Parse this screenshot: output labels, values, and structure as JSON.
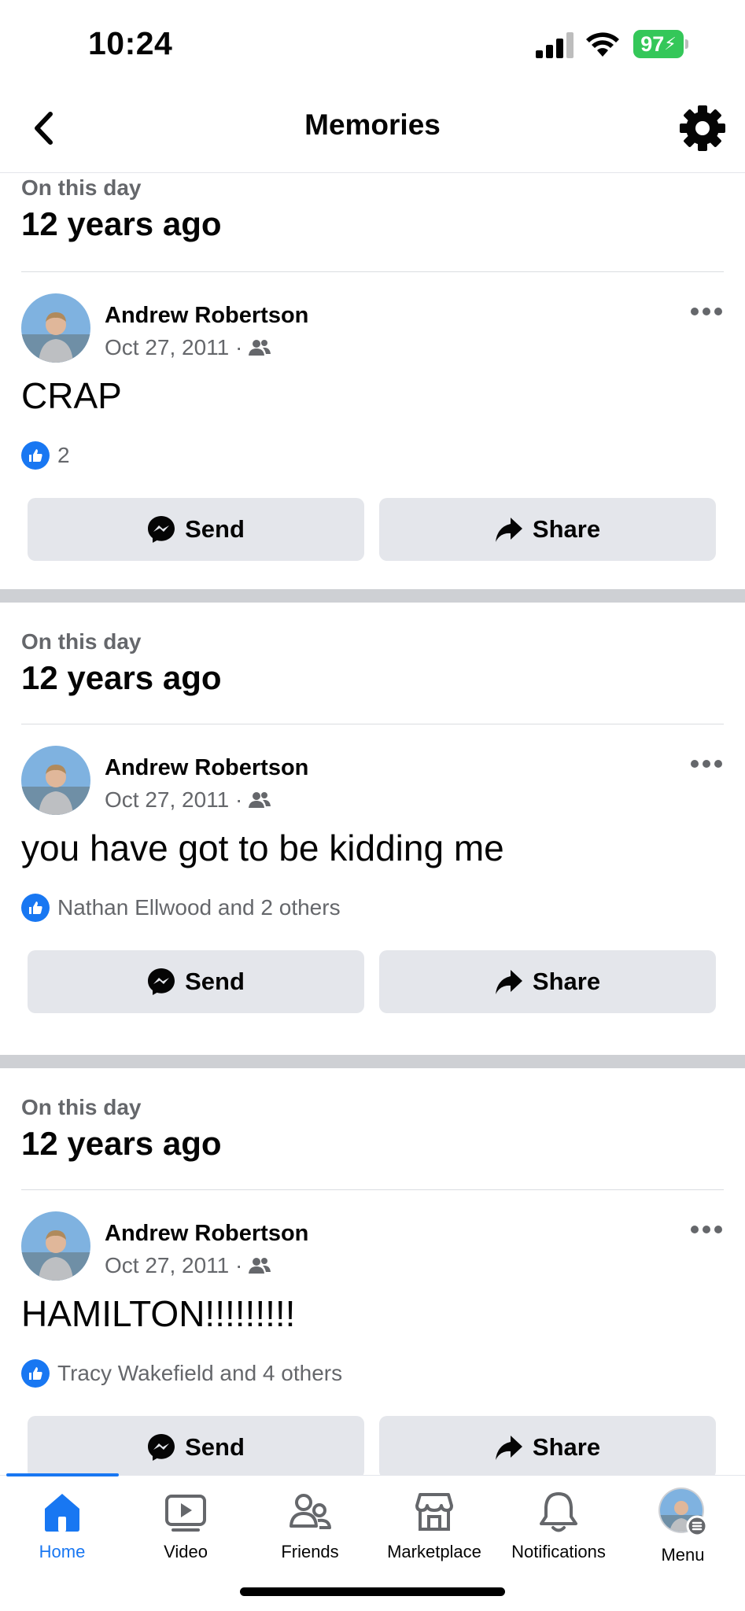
{
  "status_bar": {
    "time": "10:24",
    "battery": "97"
  },
  "header": {
    "title": "Memories"
  },
  "memories": [
    {
      "on_this_day": "On this day",
      "years_ago": "12 years ago",
      "author": "Andrew Robertson",
      "date": "Oct 27, 2011 ·",
      "text": "CRAP",
      "reactions": "2",
      "send": "Send",
      "share": "Share"
    },
    {
      "on_this_day": "On this day",
      "years_ago": "12 years ago",
      "author": "Andrew Robertson",
      "date": "Oct 27, 2011 ·",
      "text": "you have got to be kidding me",
      "reactions": "Nathan Ellwood and 2 others",
      "send": "Send",
      "share": "Share"
    },
    {
      "on_this_day": "On this day",
      "years_ago": "12 years ago",
      "author": "Andrew Robertson",
      "date": "Oct 27, 2011 ·",
      "text": "HAMILTON!!!!!!!!!",
      "reactions": "Tracy Wakefield and 4 others",
      "send": "Send",
      "share": "Share"
    }
  ],
  "tabs": [
    {
      "label": "Home",
      "icon": "home-icon",
      "active": true
    },
    {
      "label": "Video",
      "icon": "video-icon"
    },
    {
      "label": "Friends",
      "icon": "friends-icon"
    },
    {
      "label": "Marketplace",
      "icon": "marketplace-icon"
    },
    {
      "label": "Notifications",
      "icon": "bell-icon"
    },
    {
      "label": "Menu",
      "icon": "avatar-menu"
    }
  ],
  "colors": {
    "brand": "#1877f2",
    "button_bg": "#e4e6eb",
    "secondary_text": "#65676b",
    "separator": "#ced0d4"
  }
}
